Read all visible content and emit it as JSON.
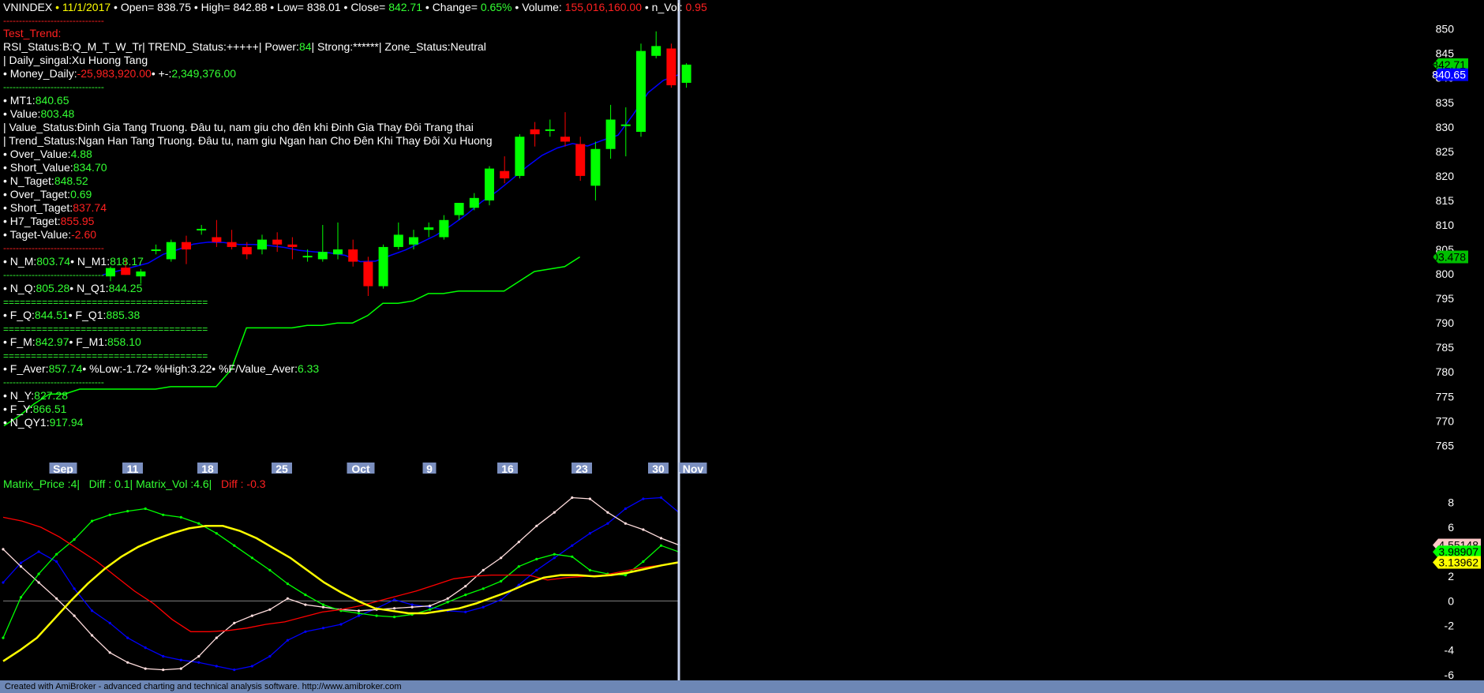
{
  "header": {
    "symbol": "VNINDEX",
    "sep": " • ",
    "date": "11/1/2017",
    "open_label": " • Open= ",
    "open": "838.75",
    "high_label": " • High= ",
    "high": "842.88",
    "low_label": " • Low= ",
    "low": "838.01",
    "close_label": " • Close= ",
    "close": "842.71",
    "change_label": " • Change= ",
    "change": "0.65%",
    "volume_label": " • Volume: ",
    "volume": "155,016,160.00",
    "nvol_label": " • n_Vol: ",
    "nvol": "0.95"
  },
  "panel": {
    "dash_short": "--------------------------------",
    "dash_eq": "=====================================",
    "test_trend": "Test_Trend:",
    "rsi_line_a": "RSI_Status:B:Q_M_T_W_Tr| TREND_Status:+++++| Power:",
    "power": "84",
    "rsi_line_b": "| Strong:******| Zone_Status:Neutral",
    "daily_signal_label": "| Daily_singal:",
    "daily_signal": "Xu Huong Tang",
    "money_label": "• Money_Daily:",
    "money": "-25,983,920.00",
    "money_pm_label": "• +-:",
    "money_pm": "2,349,376.00",
    "mt1_label": "• MT1:",
    "mt1": "840.65",
    "value_label": "• Value:",
    "value": "803.48",
    "value_status": "| Value_Status:Đinh Gia Tang Truong. Đâu tu, nam giu cho đên khi Đinh Gia Thay Đôi Trang thai",
    "trend_status": "| Trend_Status:Ngan Han Tang Truong. Đâu tu, nam giu Ngan han Cho Đên Khi Thay Đôi Xu Huong",
    "over_value_label": "• Over_Value:",
    "over_value": "4.88",
    "short_value_label": "• Short_Value:",
    "short_value": "834.70",
    "n_taget_label": "• N_Taget:",
    "n_taget": "848.52",
    "over_taget_label": "• Over_Taget:",
    "over_taget": "0.69",
    "short_taget_label": "• Short_Taget:",
    "short_taget": "837.74",
    "h7_taget_label": "• H7_Taget:",
    "h7_taget": "855.95",
    "taget_value_label": "• Taget-Value:",
    "taget_value": "-2.60",
    "n_m_label": "• N_M:",
    "n_m": "803.74",
    "n_m1_label": "• N_M1:",
    "n_m1": "818.17",
    "n_q_label": "• N_Q:",
    "n_q": "805.28",
    "n_q1_label": "• N_Q1:",
    "n_q1": "844.25",
    "f_q_label": "• F_Q:",
    "f_q": "844.51",
    "f_q1_label": "• F_Q1:",
    "f_q1": "885.38",
    "f_m_label": "• F_M:",
    "f_m": "842.97",
    "f_m1_label": "• F_M1:",
    "f_m1": "858.10",
    "f_aver_label": "• F_Aver:",
    "f_aver": "857.74",
    "pct_low_label": "• %Low:",
    "pct_low": "-1.72",
    "pct_high_label": "• %High:",
    "pct_high": "3.22",
    "fv_aver_label": "• %F/Value_Aver:",
    "fv_aver": "6.33",
    "n_y_label": "• N_Y:",
    "n_y": "827.28",
    "f_y_label": "• F_Y:",
    "f_y": "866.51",
    "n_qy1_label": "• N_QY1:",
    "n_qy1": "917.94"
  },
  "lower_header": {
    "matrix_price": "Matrix_Price :4|",
    "diff1": "Diff : 0.1|",
    "matrix_vol": "Matrix_Vol :4.6|",
    "diff2": "Diff : -0.3"
  },
  "footer": "Created with AmiBroker - advanced charting and technical analysis software. http://www.amibroker.com",
  "colors": {
    "up": "#00ff00",
    "down": "#ff0000",
    "ma": "#0000ff",
    "value_line": "#00ff00",
    "cursor": "#c8d4f0",
    "date_box": "#7b8fbf"
  },
  "chart_data": [
    {
      "type": "candlestick",
      "x_labels": [
        "Sep",
        "11",
        "18",
        "25",
        "Oct",
        "9",
        "16",
        "23",
        "30",
        "Nov"
      ],
      "x_label_dates": [
        "2017-09-01",
        "2017-09-11",
        "2017-09-18",
        "2017-09-25",
        "2017-10-02",
        "2017-10-09",
        "2017-10-16",
        "2017-10-23",
        "2017-10-30",
        "2017-11-01"
      ],
      "yticks": [
        765,
        770,
        775,
        780,
        785,
        790,
        795,
        800,
        805,
        810,
        815,
        820,
        825,
        830,
        835,
        840,
        845,
        850
      ],
      "ylim": [
        762,
        853
      ],
      "candles": [
        {
          "o": 799.5,
          "h": 801.5,
          "l": 798.5,
          "c": 801.2
        },
        {
          "o": 801.3,
          "h": 803.0,
          "l": 799.8,
          "c": 799.8
        },
        {
          "o": 799.5,
          "h": 801.0,
          "l": 798.0,
          "c": 800.5
        },
        {
          "o": 805.0,
          "h": 806.0,
          "l": 804.0,
          "c": 805.0
        },
        {
          "o": 803.0,
          "h": 807.0,
          "l": 802.5,
          "c": 806.5
        },
        {
          "o": 806.5,
          "h": 807.8,
          "l": 802.0,
          "c": 805.0
        },
        {
          "o": 809.0,
          "h": 810.0,
          "l": 808.0,
          "c": 809.2
        },
        {
          "o": 807.5,
          "h": 811.0,
          "l": 805.5,
          "c": 806.5
        },
        {
          "o": 806.5,
          "h": 809.0,
          "l": 805.0,
          "c": 805.5
        },
        {
          "o": 805.5,
          "h": 806.5,
          "l": 803.0,
          "c": 804.0
        },
        {
          "o": 805.0,
          "h": 808.0,
          "l": 804.0,
          "c": 807.0
        },
        {
          "o": 807.0,
          "h": 808.5,
          "l": 804.5,
          "c": 806.0
        },
        {
          "o": 806.0,
          "h": 807.5,
          "l": 803.0,
          "c": 805.5
        },
        {
          "o": 803.5,
          "h": 805.0,
          "l": 802.5,
          "c": 803.7
        },
        {
          "o": 803.0,
          "h": 810.0,
          "l": 802.5,
          "c": 804.5
        },
        {
          "o": 804.0,
          "h": 810.5,
          "l": 803.0,
          "c": 805.0
        },
        {
          "o": 805.0,
          "h": 807.0,
          "l": 801.5,
          "c": 802.5
        },
        {
          "o": 802.5,
          "h": 803.5,
          "l": 795.5,
          "c": 797.5
        },
        {
          "o": 797.5,
          "h": 806.0,
          "l": 797.0,
          "c": 805.5
        },
        {
          "o": 805.5,
          "h": 810.5,
          "l": 805.0,
          "c": 808.0
        },
        {
          "o": 806.0,
          "h": 809.0,
          "l": 805.0,
          "c": 807.5
        },
        {
          "o": 809.0,
          "h": 810.5,
          "l": 807.5,
          "c": 809.5
        },
        {
          "o": 807.5,
          "h": 812.0,
          "l": 807.0,
          "c": 811.0
        },
        {
          "o": 812.0,
          "h": 814.5,
          "l": 811.0,
          "c": 814.5
        },
        {
          "o": 813.5,
          "h": 816.5,
          "l": 813.0,
          "c": 815.5
        },
        {
          "o": 815.0,
          "h": 822.0,
          "l": 814.0,
          "c": 821.5
        },
        {
          "o": 821.0,
          "h": 824.0,
          "l": 818.5,
          "c": 819.5
        },
        {
          "o": 820.0,
          "h": 828.5,
          "l": 819.5,
          "c": 828.0
        },
        {
          "o": 829.5,
          "h": 831.0,
          "l": 826.0,
          "c": 828.5
        },
        {
          "o": 829.5,
          "h": 831.5,
          "l": 828.0,
          "c": 829.5
        },
        {
          "o": 828.0,
          "h": 833.0,
          "l": 826.0,
          "c": 827.0
        },
        {
          "o": 826.5,
          "h": 828.0,
          "l": 819.0,
          "c": 820.0
        },
        {
          "o": 818.0,
          "h": 827.0,
          "l": 815.0,
          "c": 825.5
        },
        {
          "o": 825.5,
          "h": 834.5,
          "l": 823.5,
          "c": 831.5
        },
        {
          "o": 830.5,
          "h": 834.0,
          "l": 824.0,
          "c": 830.5
        },
        {
          "o": 829.0,
          "h": 847.0,
          "l": 828.0,
          "c": 845.5
        },
        {
          "o": 844.5,
          "h": 849.5,
          "l": 844.0,
          "c": 846.5
        },
        {
          "o": 846.0,
          "h": 847.0,
          "l": 838.0,
          "c": 838.5
        },
        {
          "o": 839.0,
          "h": 843.0,
          "l": 838.0,
          "c": 842.71
        }
      ],
      "series": [
        {
          "name": "MT1",
          "last": 840.65,
          "values": [
            799.8,
            800.6,
            801.4,
            802.2,
            804.0,
            805.0,
            806.1,
            806.5,
            806.4,
            806.0,
            806.0,
            805.8,
            805.4,
            804.8,
            804.5,
            804.3,
            803.8,
            802.5,
            802.6,
            803.8,
            804.9,
            806.4,
            807.9,
            809.9,
            812.1,
            814.7,
            816.8,
            819.3,
            821.9,
            824.2,
            825.7,
            826.6,
            826.1,
            827.3,
            828.3,
            832.5,
            837.0,
            839.5,
            840.65
          ]
        },
        {
          "name": "Value",
          "last": 803.478,
          "values": [
            769.0,
            771.0,
            773.5,
            775.5,
            775.5,
            776.5,
            776.5,
            776.5,
            776.5,
            776.5,
            776.5,
            777.0,
            777.0,
            777.0,
            777.0,
            780.5,
            789.0,
            789.0,
            789.0,
            789.0,
            789.5,
            789.5,
            790.0,
            790.0,
            791.5,
            794.0,
            794.0,
            794.5,
            796.0,
            796.0,
            796.5,
            796.5,
            796.5,
            796.5,
            798.5,
            800.5,
            801.0,
            801.5,
            803.478
          ]
        }
      ]
    },
    {
      "type": "line",
      "yticks": [
        -6,
        -4,
        -2,
        0,
        2,
        4,
        6,
        8
      ],
      "ylim": [
        -6.2,
        9.2
      ],
      "series": [
        {
          "name": "blue",
          "color": "#0000ff",
          "last": null,
          "values": [
            1.5,
            3.1,
            4.0,
            3.2,
            1.0,
            -0.8,
            -1.8,
            -3.0,
            -3.8,
            -4.5,
            -4.8,
            -5.0,
            -5.3,
            -5.6,
            -5.3,
            -4.5,
            -3.2,
            -2.5,
            -2.2,
            -1.9,
            -1.2,
            -0.6,
            0.1,
            -0.3,
            -0.5,
            -0.8,
            -0.9,
            -0.5,
            0.1,
            1.3,
            2.5,
            3.5,
            4.5,
            5.5,
            6.3,
            7.5,
            8.3,
            8.4,
            7.2
          ]
        },
        {
          "name": "pink",
          "color": "#ffdddd",
          "last": 4.55148,
          "values": [
            4.2,
            2.8,
            1.5,
            0.2,
            -1.2,
            -2.8,
            -4.2,
            -5.0,
            -5.5,
            -5.6,
            -5.5,
            -4.5,
            -3.0,
            -1.8,
            -1.2,
            -0.7,
            0.2,
            -0.3,
            -0.5,
            -0.7,
            -0.8,
            -0.7,
            -0.6,
            -0.5,
            -0.4,
            0.2,
            1.2,
            2.5,
            3.5,
            4.8,
            6.1,
            7.2,
            8.4,
            8.3,
            7.2,
            6.3,
            5.8,
            5.1,
            4.55
          ]
        },
        {
          "name": "green",
          "color": "#00ff00",
          "last": 3.98907,
          "values": [
            -3.0,
            0.3,
            2.2,
            3.8,
            5.0,
            6.5,
            7.0,
            7.3,
            7.5,
            7.0,
            6.8,
            6.3,
            5.5,
            4.5,
            3.5,
            2.5,
            1.4,
            0.5,
            -0.3,
            -0.8,
            -1.0,
            -1.2,
            -1.3,
            -1.1,
            -0.7,
            -0.1,
            0.5,
            1.0,
            1.6,
            2.8,
            3.4,
            3.8,
            3.6,
            2.5,
            2.2,
            2.1,
            3.2,
            4.5,
            3.99
          ]
        },
        {
          "name": "red",
          "color": "#ff0000",
          "last": null,
          "values": [
            6.8,
            6.5,
            6.0,
            5.2,
            4.2,
            3.2,
            2.0,
            0.8,
            -0.2,
            -1.5,
            -2.5,
            -2.5,
            -2.4,
            -2.2,
            -1.9,
            -1.7,
            -1.3,
            -0.9,
            -0.7,
            -0.4,
            0.0,
            0.4,
            0.8,
            1.3,
            1.8,
            2.0,
            2.1,
            2.1,
            2.1,
            1.7,
            1.9,
            2.0,
            2.1,
            2.4,
            2.7,
            2.9,
            3.1
          ]
        },
        {
          "name": "yellow",
          "color": "#ffff00",
          "last": 3.13962,
          "values": [
            -4.9,
            -4.0,
            -3.0,
            -1.5,
            0.0,
            1.4,
            2.6,
            3.6,
            4.4,
            5.0,
            5.5,
            5.9,
            6.1,
            6.1,
            5.7,
            5.1,
            4.3,
            3.5,
            2.5,
            1.5,
            0.7,
            0.0,
            -0.6,
            -0.8,
            -1.0,
            -1.0,
            -0.8,
            -0.6,
            -0.2,
            0.3,
            0.8,
            1.4,
            1.9,
            2.1,
            2.1,
            2.0,
            2.1,
            2.3,
            2.6,
            2.9,
            3.14
          ]
        }
      ],
      "flags": [
        {
          "value": 4.55148,
          "label": "4.55148",
          "bg": "#ffc8c8",
          "fg": "#000000"
        },
        {
          "value": 3.98907,
          "label": "3.98907",
          "bg": "#00ff00",
          "fg": "#000000"
        },
        {
          "value": 3.13962,
          "label": "3.13962",
          "bg": "#ffff00",
          "fg": "#000000"
        }
      ]
    }
  ],
  "price_flags": [
    {
      "value": 842.71,
      "label": "842.71",
      "bg": "#00d000",
      "fg": "#000000"
    },
    {
      "value": 840.65,
      "label": "840.65",
      "bg": "#0000ff",
      "fg": "#ffffff"
    },
    {
      "value": 803.478,
      "label": "803.478",
      "bg": "#00c000",
      "fg": "#000000"
    }
  ]
}
